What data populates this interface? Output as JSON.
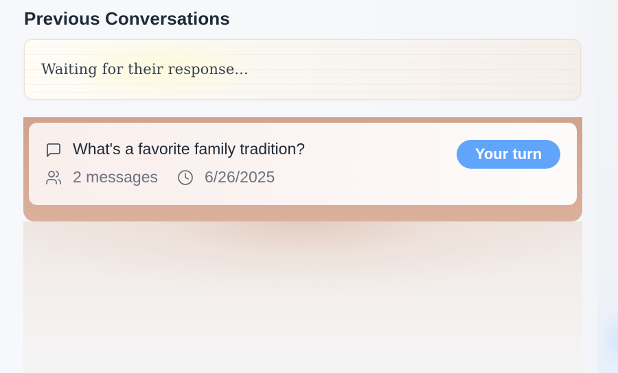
{
  "section": {
    "title": "Previous Conversations"
  },
  "waiting_card": {
    "text": "Waiting for their response..."
  },
  "conversations": [
    {
      "title": "What's a favorite family tradition?",
      "message_count": "2 messages",
      "date": "6/26/2025",
      "status": "Your turn",
      "icons": {
        "title": "message-square-icon",
        "count": "users-icon",
        "date": "clock-icon"
      }
    }
  ],
  "colors": {
    "title_text": "#1f2937",
    "meta_text": "#6b7280",
    "badge_bg": "#60a5fa",
    "badge_text": "#ffffff",
    "frame_accent": "#d4a892"
  }
}
